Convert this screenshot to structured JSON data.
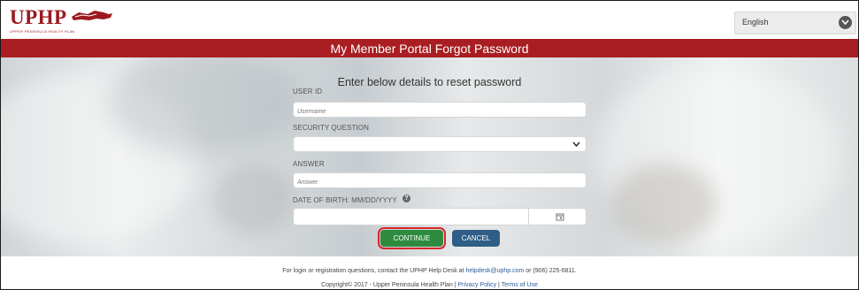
{
  "header": {
    "logo_text": "UPHP",
    "logo_tagline": "UPPER PENINSULA HEALTH PLAN",
    "language": "English"
  },
  "title_bar": "My Member Portal Forgot Password",
  "form": {
    "heading": "Enter below details to reset password",
    "user_id": {
      "label": "USER ID",
      "placeholder": "Username"
    },
    "security_question": {
      "label": "SECURITY QUESTION",
      "value": ""
    },
    "answer": {
      "label": "ANSWER",
      "placeholder": "Answer"
    },
    "dob": {
      "label": "DATE OF BIRTH: MM/DD/YYYY",
      "value": ""
    },
    "continue_label": "CONTINUE",
    "cancel_label": "CANCEL"
  },
  "footer": {
    "line1_prefix": "For login or registration questions, contact the UPHP Help Desk at ",
    "help_email": "helpdesk@uphp.com",
    "line1_suffix": " or (906) 225-6811.",
    "copyright": "Copyright© 2017 - Upper Peninsula Health Plan | ",
    "privacy": "Privacy Policy",
    "sep": " | ",
    "terms": "Terms of Use"
  },
  "colors": {
    "brand_red": "#a91e22",
    "continue_green": "#2e8b3e",
    "cancel_blue": "#2f5e86",
    "highlight_red": "#d8262c"
  }
}
